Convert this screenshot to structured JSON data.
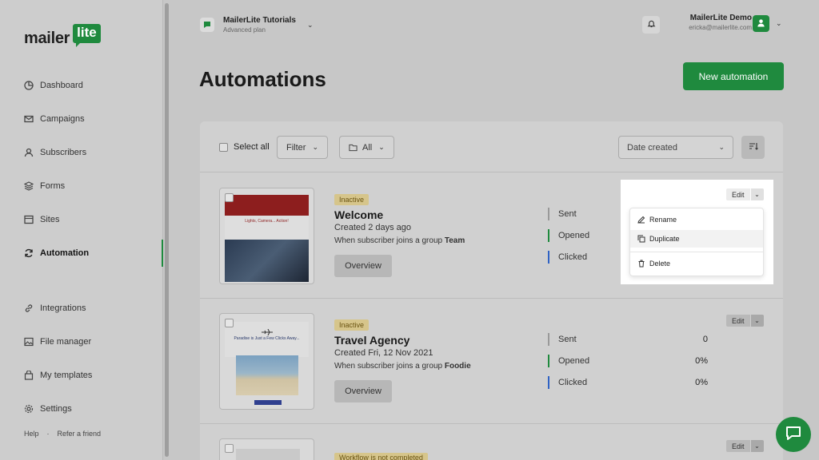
{
  "logo": {
    "text": "mailer",
    "badge": "lite"
  },
  "sidebar": {
    "items": [
      {
        "label": "Dashboard",
        "icon": "dashboard-icon"
      },
      {
        "label": "Campaigns",
        "icon": "mail-icon"
      },
      {
        "label": "Subscribers",
        "icon": "user-icon"
      },
      {
        "label": "Forms",
        "icon": "layers-icon"
      },
      {
        "label": "Sites",
        "icon": "browser-icon"
      },
      {
        "label": "Automation",
        "icon": "refresh-icon"
      },
      {
        "label": "Integrations",
        "icon": "link-icon"
      },
      {
        "label": "File manager",
        "icon": "image-icon"
      },
      {
        "label": "My templates",
        "icon": "template-icon"
      },
      {
        "label": "Settings",
        "icon": "gear-icon"
      }
    ],
    "active": "Automation",
    "footer": {
      "help": "Help",
      "dot": "·",
      "refer": "Refer a friend"
    }
  },
  "account": {
    "name": "MailerLite Tutorials",
    "plan": "Advanced plan"
  },
  "user": {
    "name": "MailerLite Demo",
    "email": "ericka@mailerlite.com"
  },
  "page": {
    "title": "Automations",
    "new_button": "New automation"
  },
  "toolbar": {
    "select_all": "Select all",
    "filter": "Filter",
    "folder": "All",
    "sort": "Date created"
  },
  "automations": [
    {
      "status": "Inactive",
      "title": "Welcome",
      "created": "Created 2 days ago",
      "trigger_prefix": "When subscriber joins a group ",
      "trigger_group": "Team",
      "overview": "Overview",
      "stats": [
        {
          "label": "Sent",
          "value": ""
        },
        {
          "label": "Opened",
          "value": ""
        },
        {
          "label": "Clicked",
          "value": ""
        }
      ],
      "thumb_text": "Lights, Camera... Action!"
    },
    {
      "status": "Inactive",
      "title": "Travel Agency",
      "created": "Created Fri, 12 Nov 2021",
      "trigger_prefix": "When subscriber joins a group ",
      "trigger_group": "Foodie",
      "overview": "Overview",
      "stats": [
        {
          "label": "Sent",
          "value": "0"
        },
        {
          "label": "Opened",
          "value": "0%"
        },
        {
          "label": "Clicked",
          "value": "0%"
        }
      ],
      "thumb_text": "Paradise is Just a Few Clicks Away..."
    },
    {
      "status": "Workflow is not completed"
    }
  ],
  "edit_label": "Edit",
  "context_menu": {
    "rename": "Rename",
    "duplicate": "Duplicate",
    "delete": "Delete"
  },
  "colors": {
    "brand_green": "#1f8a3e",
    "opened": "#1f8a3e",
    "clicked": "#2f62c4",
    "badge": "#d6c58b"
  }
}
